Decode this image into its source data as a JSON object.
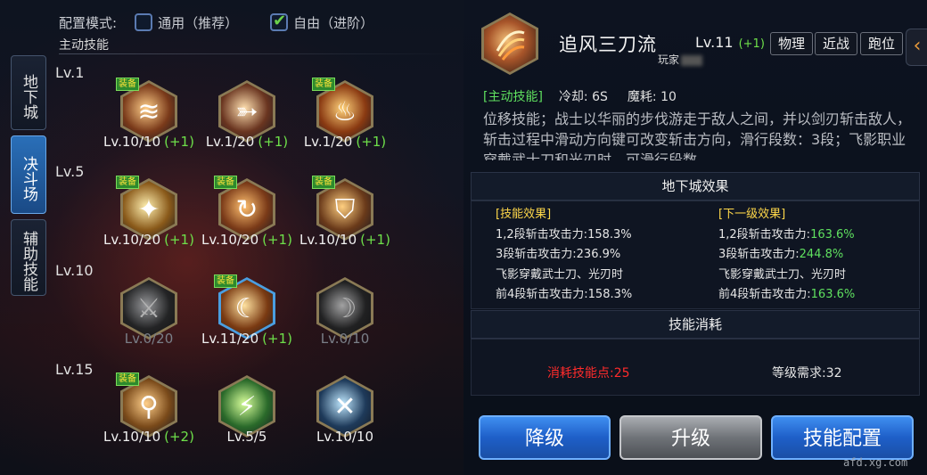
{
  "config": {
    "label": "配置模式:",
    "options": [
      {
        "label": "通用（推荐）",
        "checked": false
      },
      {
        "label": "自由（进阶）",
        "checked": true
      }
    ]
  },
  "section_title": "主动技能",
  "side_tabs": [
    {
      "label": "地下城",
      "active": false
    },
    {
      "label": "决斗场",
      "active": true
    },
    {
      "label": "辅助技能",
      "active": false
    }
  ],
  "equip_badge": "装备",
  "skill_rows": [
    {
      "level": "Lv.1",
      "skills": [
        {
          "icon": "slash-wave-icon",
          "equipped": true,
          "level": "Lv.10/10",
          "plus": "(+1)",
          "dim": false,
          "selected": false
        },
        {
          "icon": "dash-strike-icon",
          "equipped": false,
          "level": "Lv.1/20",
          "plus": "(+1)",
          "dim": false,
          "selected": false
        },
        {
          "icon": "flame-slash-icon",
          "equipped": true,
          "level": "Lv.1/20",
          "plus": "(+1)",
          "dim": false,
          "selected": false
        }
      ]
    },
    {
      "level": "Lv.5",
      "skills": [
        {
          "icon": "sword-burst-icon",
          "equipped": true,
          "level": "Lv.10/20",
          "plus": "(+1)",
          "dim": false,
          "selected": false
        },
        {
          "icon": "whirl-blade-icon",
          "equipped": true,
          "level": "Lv.10/20",
          "plus": "(+1)",
          "dim": false,
          "selected": false
        },
        {
          "icon": "shield-sword-icon",
          "equipped": true,
          "level": "Lv.10/10",
          "plus": "(+1)",
          "dim": false,
          "selected": false
        }
      ]
    },
    {
      "level": "Lv.10",
      "skills": [
        {
          "icon": "storm-blade-icon",
          "equipped": false,
          "level": "Lv.0/20",
          "plus": "",
          "dim": true,
          "selected": false
        },
        {
          "icon": "triple-slash-icon",
          "equipped": true,
          "level": "Lv.11/20",
          "plus": "(+1)",
          "dim": false,
          "selected": true
        },
        {
          "icon": "moon-beast-icon",
          "equipped": false,
          "level": "Lv.0/10",
          "plus": "",
          "dim": true,
          "selected": false
        }
      ]
    },
    {
      "level": "Lv.15",
      "skills": [
        {
          "icon": "swordsman-icon",
          "equipped": true,
          "level": "Lv.10/10",
          "plus": "(+2)",
          "dim": false,
          "selected": false
        },
        {
          "icon": "green-blade-icon",
          "equipped": false,
          "level": "Lv.5/5",
          "plus": "",
          "dim": false,
          "selected": false
        },
        {
          "icon": "cross-swords-icon",
          "equipped": false,
          "level": "Lv.10/10",
          "plus": "",
          "dim": false,
          "selected": false
        }
      ]
    }
  ],
  "detail": {
    "icon": "triple-slash-icon",
    "name": "追风三刀流",
    "level": "Lv.11",
    "level_plus": "(+1)",
    "player_label": "玩家",
    "tags": [
      "物理",
      "近战",
      "跑位"
    ],
    "type": "[主动技能]",
    "cooldown_label": "冷却:",
    "cooldown": "6S",
    "mana_label": "魔耗:",
    "mana": "10",
    "description": "位移技能；战士以华丽的步伐游走于敌人之间，并以剑刃斩击敌人，斩击过程中滑动方向键可改变斩击方向，滑行段数：3段；飞影职业穿戴武士刀和光刃时，可滑行段数"
  },
  "dungeon_effect": {
    "title": "地下城效果",
    "current_title": "[技能效果]",
    "next_title": "[下一级效果]",
    "current": [
      {
        "label": "1,2段斩击攻击力:",
        "value": "158.3%"
      },
      {
        "label": "3段斩击攻击力:",
        "value": "236.9%"
      },
      {
        "label": "飞影穿戴武士刀、光刃时",
        "value": ""
      },
      {
        "label": "前4段斩击攻击力:",
        "value": "158.3%"
      }
    ],
    "next": [
      {
        "label": "1,2段斩击攻击力:",
        "value": "163.6%"
      },
      {
        "label": "3段斩击攻击力:",
        "value": "244.8%"
      },
      {
        "label": "飞影穿戴武士刀、光刃时",
        "value": ""
      },
      {
        "label": "前4段斩击攻击力:",
        "value": "163.6%"
      }
    ]
  },
  "cost": {
    "title": "技能消耗",
    "points": "消耗技能点:25",
    "level_req": "等级需求:32"
  },
  "buttons": {
    "downgrade": "降级",
    "upgrade": "升级",
    "config": "技能配置"
  },
  "collapse_arrow": "‹",
  "watermark": "afd.xg.com"
}
